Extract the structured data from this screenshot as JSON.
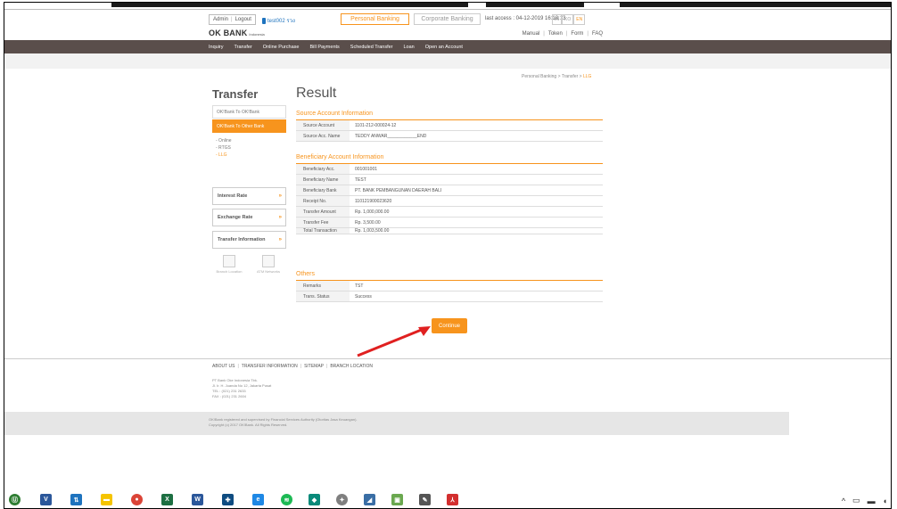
{
  "header": {
    "admin_label": "Admin",
    "logout_label": "Logout",
    "user_label": "test002 รวง",
    "tab_personal": "Personal Banking",
    "tab_corporate": "Corporate Banking",
    "last_access": "last access : 04-12-2019 16:18:13",
    "langs": [
      "IN",
      "KO",
      "EN"
    ],
    "logo_brand": "OK BANK",
    "logo_sub": "Indonesia",
    "util_links": [
      "Manual",
      "Token",
      "Form",
      "FAQ"
    ]
  },
  "nav": {
    "items": [
      "Inquiry",
      "Transfer",
      "Online Purchase",
      "Bill Payments",
      "Scheduled Transfer",
      "Loan",
      "Open an Account"
    ]
  },
  "breadcrumb": {
    "root": "Personal Banking",
    "mid": "Transfer",
    "current": "LLG",
    "sep": ">"
  },
  "sidebar": {
    "title": "Transfer",
    "menu": [
      "OK!Bank To OK!Bank",
      "OK!Bank To Other Bank"
    ],
    "sub": [
      "- Online",
      "- RTGS",
      "- LLG"
    ],
    "boxes": [
      "Interest Rate",
      "Exchange Rate",
      "Transfer Information"
    ],
    "icons": [
      "Branch Location",
      "ATM Networks"
    ]
  },
  "main": {
    "title": "Result",
    "source_title": "Source Account Information",
    "source_rows": [
      {
        "label": "Source Account",
        "value": "1101-212-000024-12"
      },
      {
        "label": "Source Acc. Name",
        "value": "TEDDY ANWAR____________END"
      }
    ],
    "beneficiary_title": "Beneficiary Account Information",
    "beneficiary_rows": [
      {
        "label": "Beneficiary Acc.",
        "value": "001001001"
      },
      {
        "label": "Beneficiary Name",
        "value": "TEST"
      },
      {
        "label": "Beneficiary Bank",
        "value": "PT. BANK PEMBANGUNAN DAERAH BALI"
      },
      {
        "label": "Receipt No.",
        "value": "110121900023620"
      },
      {
        "label": "Transfer Amount",
        "value": "Rp. 1,000,000.00"
      },
      {
        "label": "Transfer Fee",
        "value": "Rp. 3,500.00"
      },
      {
        "label": "Total Transaction",
        "value": "Rp. 1,003,500.00"
      }
    ],
    "others_title": "Others",
    "others_rows": [
      {
        "label": "Remarks",
        "value": "TST"
      },
      {
        "label": "Trans. Status",
        "value": "Success"
      }
    ],
    "continue_label": "Continue"
  },
  "footer": {
    "links": [
      "ABOUT US",
      "TRANSFER INFORMATION",
      "SITEMAP",
      "BRANCH LOCATION"
    ],
    "addr": [
      "PT Bank Oke Indonesia Tbk.",
      "Jl. Ir. H. Juanda No 12, Jakarta Pusat",
      "TEL : (021) 231 2633",
      "FAX : (021) 231 2604"
    ],
    "legal": [
      "OK!Bank registered and supervised by Financial Services Authority (Otoritas Jasa Keuangan).",
      "Copyright (c) 2017 OK!Bank. All Rights Reserved."
    ]
  },
  "taskbar": {
    "icons": [
      {
        "name": "start-icon",
        "color": "#2e7d32",
        "glyph": "Ⓤ"
      },
      {
        "name": "visio-icon",
        "color": "#2b579a",
        "glyph": "V"
      },
      {
        "name": "network-icon",
        "color": "#1e73be",
        "glyph": "⇅"
      },
      {
        "name": "folder-icon",
        "color": "#f5c400",
        "glyph": "▬"
      },
      {
        "name": "chrome-icon",
        "color": "#db4437",
        "glyph": "●"
      },
      {
        "name": "excel-icon",
        "color": "#1d6f42",
        "glyph": "X"
      },
      {
        "name": "word-icon",
        "color": "#2b579a",
        "glyph": "W"
      },
      {
        "name": "app-icon",
        "color": "#0f4c81",
        "glyph": "✚"
      },
      {
        "name": "edge-icon",
        "color": "#1e88e5",
        "glyph": "e"
      },
      {
        "name": "spotify-icon",
        "color": "#1db954",
        "glyph": "≋"
      },
      {
        "name": "bird-icon",
        "color": "#0a8a7a",
        "glyph": "◆"
      },
      {
        "name": "game-icon",
        "color": "#7f7f7f",
        "glyph": "✦"
      },
      {
        "name": "tool-icon",
        "color": "#3a6ea5",
        "glyph": "◢"
      },
      {
        "name": "image-icon",
        "color": "#6aa84f",
        "glyph": "▣"
      },
      {
        "name": "paint-icon",
        "color": "#555555",
        "glyph": "✎"
      },
      {
        "name": "pdf-icon",
        "color": "#d32f2f",
        "glyph": "⅄"
      }
    ]
  },
  "colors": {
    "accent": "#f7941d",
    "navbar": "#5a4e4b",
    "arrow": "#e02020"
  }
}
